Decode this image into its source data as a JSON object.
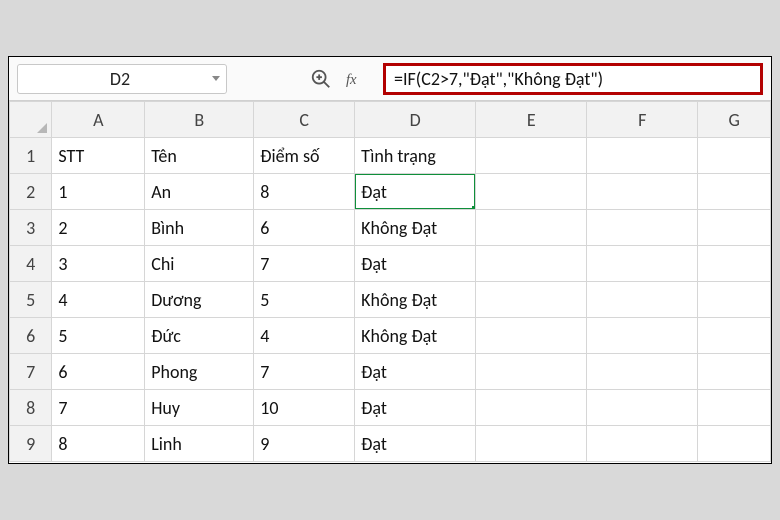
{
  "name_box": {
    "value": "D2"
  },
  "formula_bar": {
    "value": "=IF(C2>7,\"Đạt\",\"Không Đạt\")"
  },
  "columns": [
    "A",
    "B",
    "C",
    "D",
    "E",
    "F",
    "G"
  ],
  "row_numbers": [
    1,
    2,
    3,
    4,
    5,
    6,
    7,
    8,
    9
  ],
  "selected": {
    "row": 2,
    "col": "D"
  },
  "headers": {
    "A": "STT",
    "B": "Tên",
    "C": "Điểm số",
    "D": "Tình trạng"
  },
  "rows": [
    {
      "A": 1,
      "B": "An",
      "C": 8,
      "D": "Đạt"
    },
    {
      "A": 2,
      "B": "Bình",
      "C": 6,
      "D": "Không Đạt"
    },
    {
      "A": 3,
      "B": "Chi",
      "C": 7,
      "D": "Đạt"
    },
    {
      "A": 4,
      "B": "Dương",
      "C": 5,
      "D": "Không Đạt"
    },
    {
      "A": 5,
      "B": "Đức",
      "C": 4,
      "D": "Không Đạt"
    },
    {
      "A": 6,
      "B": "Phong",
      "C": 7,
      "D": "Đạt"
    },
    {
      "A": 7,
      "B": "Huy",
      "C": 10,
      "D": "Đạt"
    },
    {
      "A": 8,
      "B": "Linh",
      "C": 9,
      "D": "Đạt"
    }
  ],
  "icons": {
    "zoom": "zoom-icon",
    "fx": "fx-icon"
  }
}
